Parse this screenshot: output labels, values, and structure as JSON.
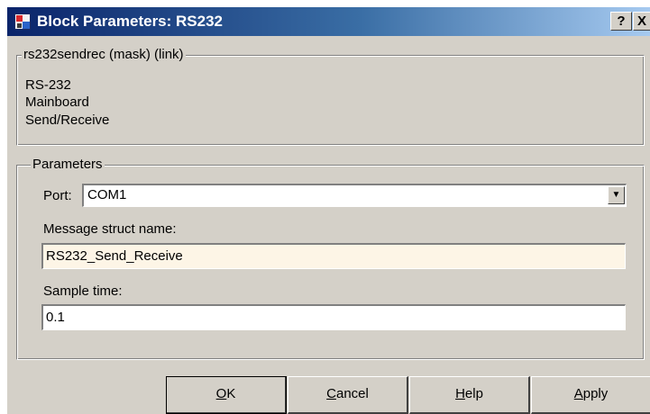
{
  "window": {
    "title": "Block Parameters: RS232",
    "help_label": "?",
    "close_label": "X"
  },
  "mask": {
    "legend": "rs232sendrec (mask) (link)",
    "lines": [
      "RS-232",
      "Mainboard",
      "Send/Receive"
    ]
  },
  "parameters": {
    "legend": "Parameters",
    "port_label": "Port:",
    "port_value": "COM1",
    "struct_label": "Message struct name:",
    "struct_value": "RS232_Send_Receive",
    "sample_label": "Sample time:",
    "sample_value": "0.1"
  },
  "buttons": {
    "ok": {
      "mnemonic": "O",
      "rest": "K"
    },
    "cancel": {
      "mnemonic": "C",
      "rest": "ancel"
    },
    "help": {
      "mnemonic": "H",
      "rest": "elp"
    },
    "apply": {
      "mnemonic": "A",
      "rest": "pply"
    }
  },
  "colors": {
    "title_start": "#0a246a",
    "title_end": "#a6caf0",
    "dialog_face": "#d4d0c8",
    "focused_field": "#fdf5e6"
  },
  "icons": {
    "app": "simulink-block-icon",
    "dropdown": "chevron-down-icon"
  }
}
